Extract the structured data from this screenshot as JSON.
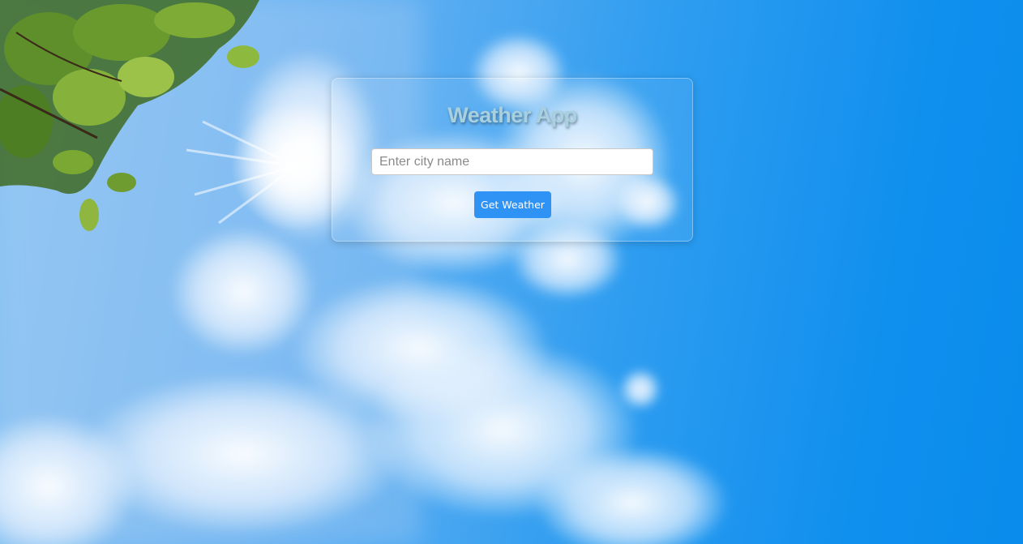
{
  "app": {
    "title": "Weather App"
  },
  "search": {
    "placeholder": "Enter city name",
    "value": "",
    "button_label": "Get Weather"
  },
  "colors": {
    "sky": "#2f9df0",
    "button": "#2f92f5",
    "title": "#a8d0de"
  }
}
